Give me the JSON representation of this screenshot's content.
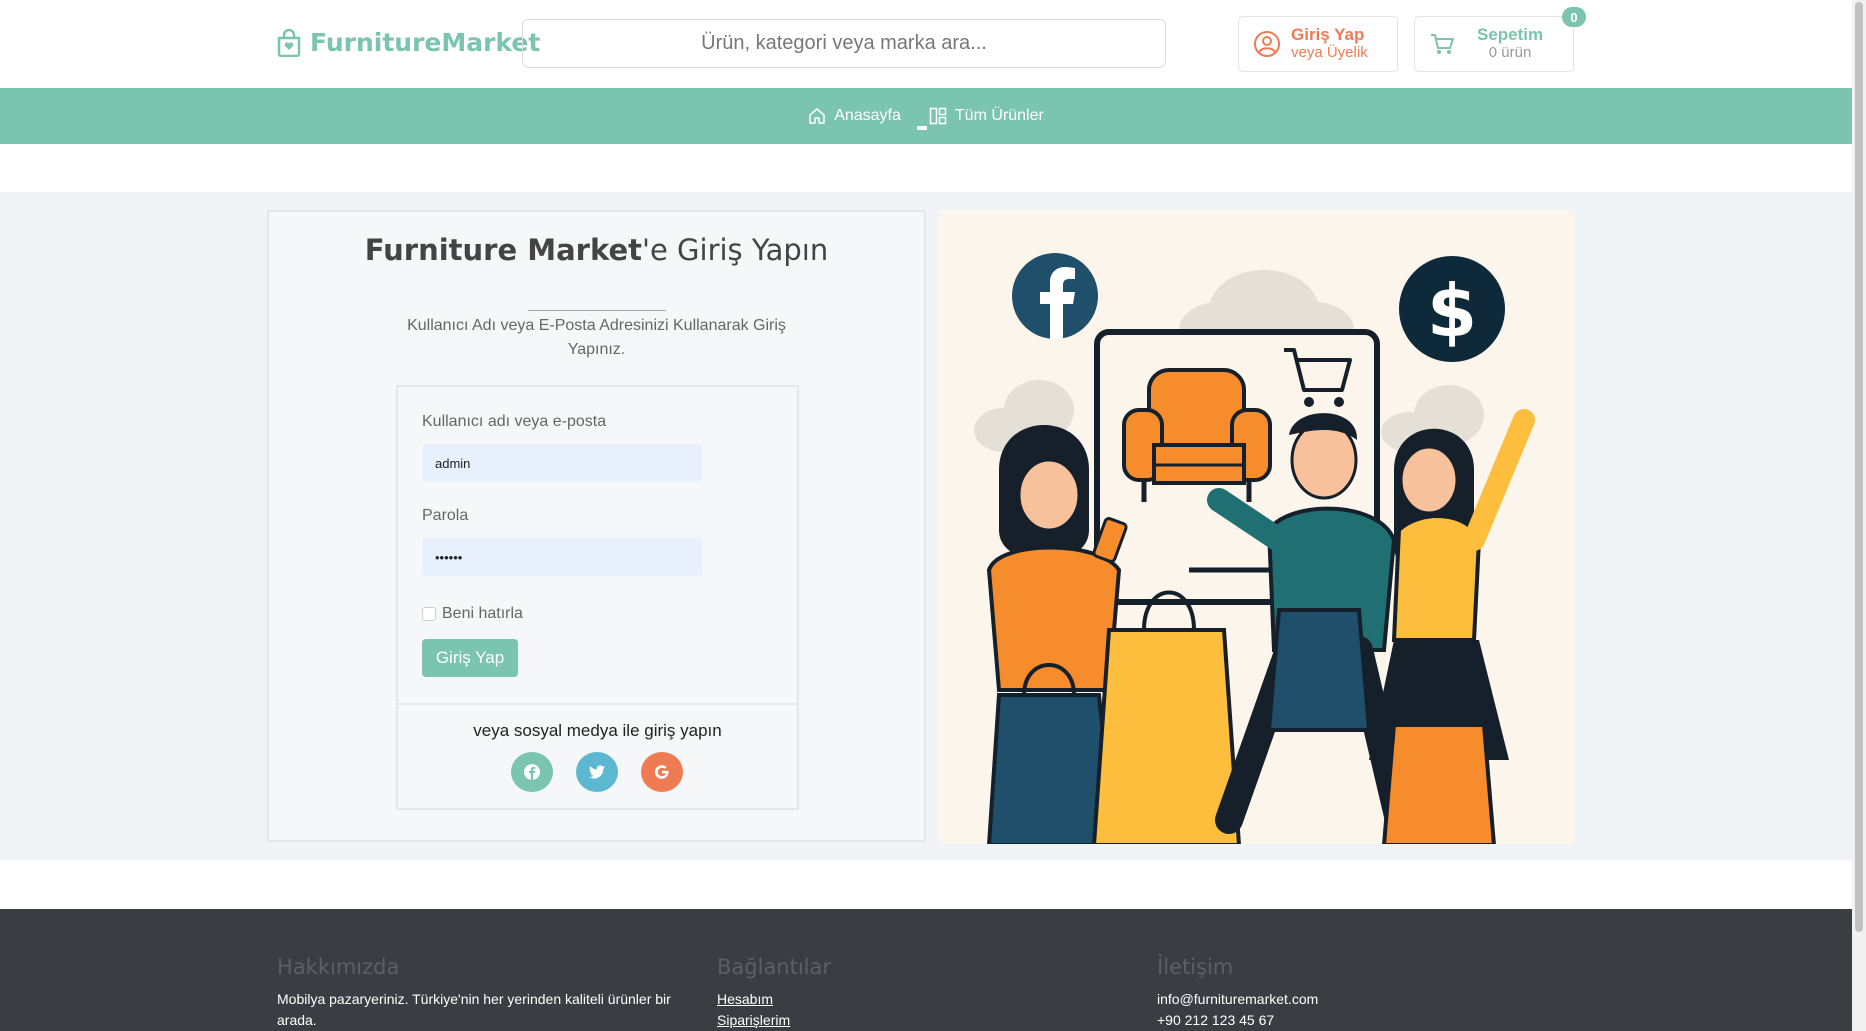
{
  "header": {
    "logo_text": "FurnitureMarket",
    "search_placeholder": "Ürün, kategori veya marka ara...",
    "login_title": "Giriş Yap",
    "login_subtitle": "veya Üyelik",
    "cart_title": "Sepetim",
    "cart_subtitle": "0 ürün",
    "cart_count": "0"
  },
  "nav": {
    "items": [
      {
        "label": "Anasayfa",
        "icon": "home-icon"
      },
      {
        "label": "Tüm Ürünler",
        "icon": "grid-icon"
      }
    ]
  },
  "login": {
    "title_bold": "Furniture Market",
    "title_rest": "'e Giriş Yapın",
    "subtitle": "Kullanıcı Adı veya E-Posta Adresinizi Kullanarak Giriş Yapınız.",
    "username_label": "Kullanıcı adı veya e-posta",
    "username_value": "admin",
    "password_label": "Parola",
    "password_value": "••••••",
    "remember_label": "Beni hatırla",
    "submit_label": "Giriş Yap",
    "social_text": "veya sosyal medya ile giriş yapın",
    "social": [
      {
        "name": "facebook",
        "color": "#7bc4ad"
      },
      {
        "name": "twitter",
        "color": "#5bb8d0"
      },
      {
        "name": "google",
        "color": "#ef7b55"
      }
    ]
  },
  "footer": {
    "about_title": "Hakkımızda",
    "about_text": "Mobilya pazaryeriniz. Türkiye'nin her yerinden kaliteli ürünler bir arada.",
    "links_title": "Bağlantılar",
    "links": [
      "Hesabım",
      "Siparişlerim"
    ],
    "contact_title": "İletişim",
    "contact_email": "info@furnituremarket.com",
    "contact_phone": "+90 212 123 45 67"
  },
  "colors": {
    "brand": "#7bc4ad",
    "accent": "#ef7b55",
    "footer_bg": "#3a3d42"
  }
}
